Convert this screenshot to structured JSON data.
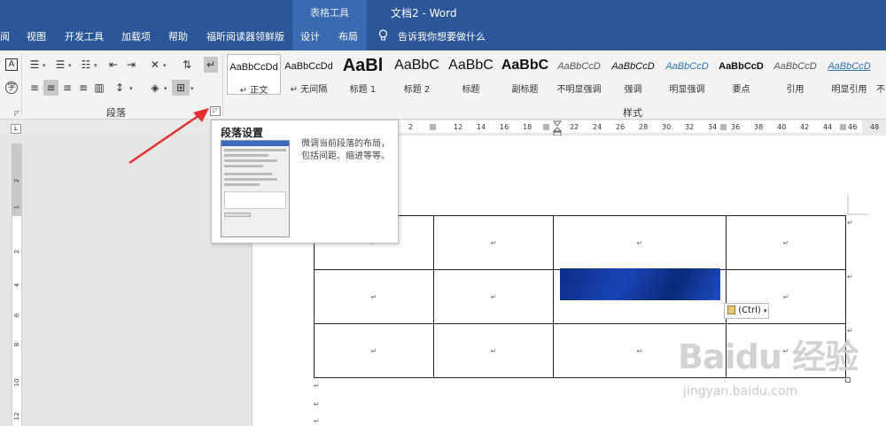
{
  "window": {
    "title": "文档2  -  Word",
    "context_tab_group": "表格工具"
  },
  "tabs": [
    {
      "label": "阅"
    },
    {
      "label": "视图"
    },
    {
      "label": "开发工具"
    },
    {
      "label": "加载项"
    },
    {
      "label": "帮助"
    },
    {
      "label": "福昕阅读器领鲜版"
    },
    {
      "label": "设计"
    },
    {
      "label": "布局"
    }
  ],
  "tell_me": "告诉我你想要做什么",
  "ribbon": {
    "paragraph_group": "段落",
    "styles_group": "样式",
    "styles": [
      {
        "sample": "AaBbCcDd",
        "name": "↵ 正文",
        "selected": true
      },
      {
        "sample": "AaBbCcDd",
        "name": "↵ 无间隔"
      },
      {
        "sample": "AaBl",
        "name": "标题 1"
      },
      {
        "sample": "AaBbC",
        "name": "标题 2"
      },
      {
        "sample": "AaBbC",
        "name": "标题"
      },
      {
        "sample": "AaBbC",
        "name": "副标题"
      },
      {
        "sample": "AaBbCcD",
        "name": "不明显强调"
      },
      {
        "sample": "AaBbCcD",
        "name": "强调"
      },
      {
        "sample": "AaBbCcD",
        "name": "明显强调"
      },
      {
        "sample": "AaBbCcD",
        "name": "要点"
      },
      {
        "sample": "AaBbCcD",
        "name": "引用"
      },
      {
        "sample": "AaBbCcD",
        "name": "明显引用"
      },
      {
        "sample": "",
        "name": "不"
      }
    ]
  },
  "tooltip": {
    "title": "段落设置",
    "description": "微调当前段落的布局，包括间距、缩进等等。"
  },
  "ruler": {
    "numbers": [
      "2",
      "12",
      "14",
      "16",
      "18",
      "22",
      "24",
      "26",
      "28",
      "30",
      "32",
      "34",
      "36",
      "38",
      "40",
      "42",
      "44",
      "46",
      "48"
    ],
    "vertical_numbers": [
      "2",
      "1",
      "2",
      "4",
      "6",
      "8",
      "10",
      "12"
    ]
  },
  "document": {
    "paragraph_mark": "↵",
    "paste_options": "(Ctrl)"
  },
  "watermark": {
    "text": "Baidu 经验",
    "url": "jingyan.baidu.com"
  },
  "colors": {
    "titlebar": "#2b579a",
    "accent_arrow": "#e03030"
  }
}
